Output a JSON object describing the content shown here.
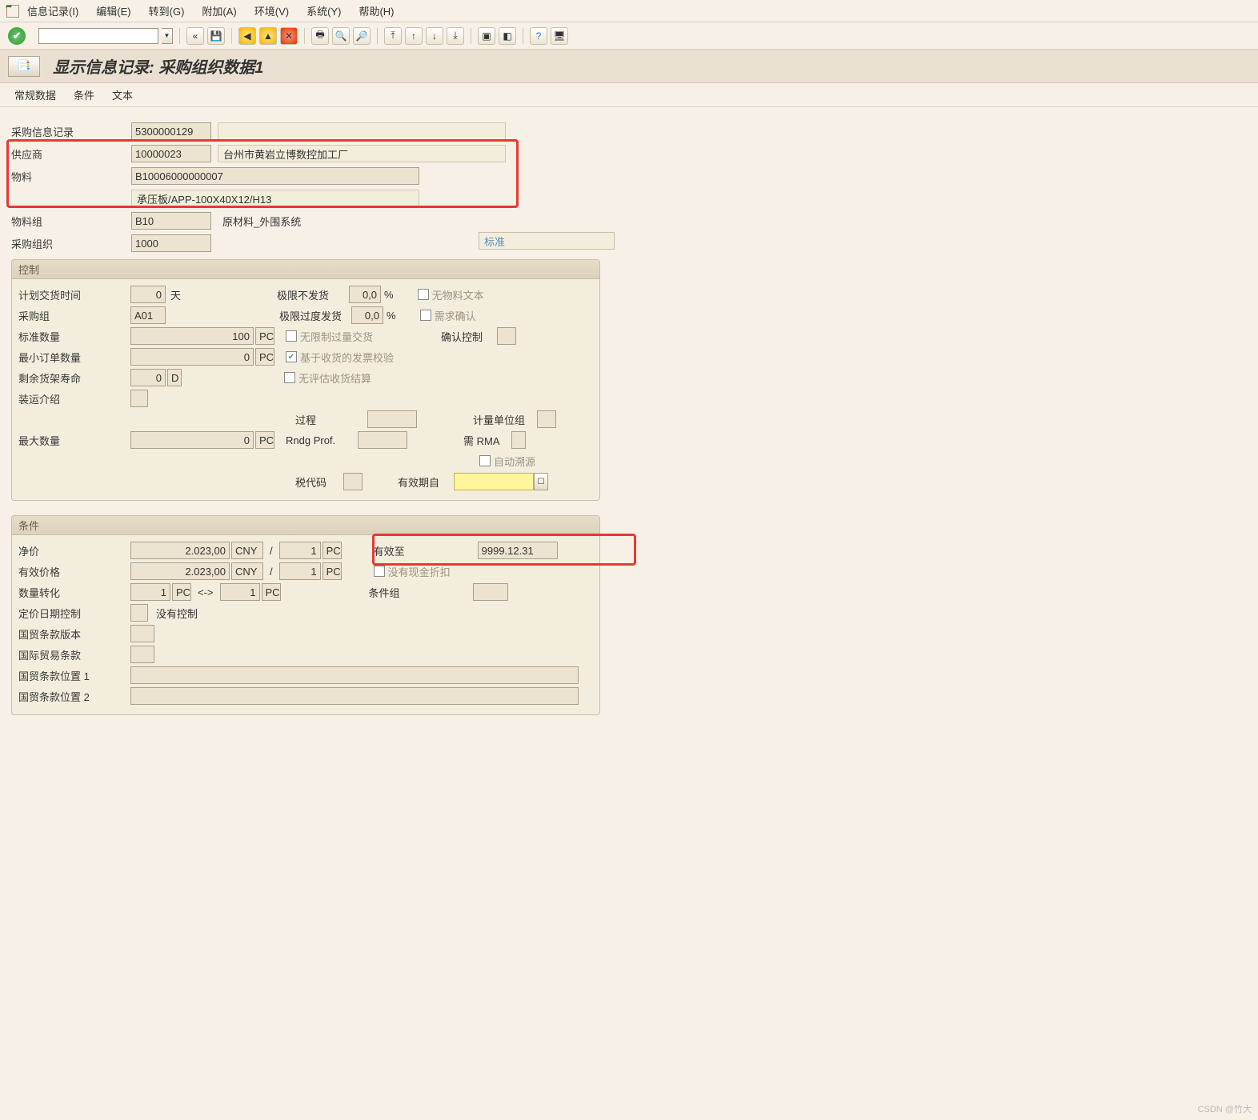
{
  "menubar": [
    "信息记录(I)",
    "编辑(E)",
    "转到(G)",
    "附加(A)",
    "环境(V)",
    "系统(Y)",
    "帮助(H)"
  ],
  "page_title": "显示信息记录: 采购组织数据1",
  "subtabs": [
    "常规数据",
    "条件",
    "文本"
  ],
  "header": {
    "record_label": "采购信息记录",
    "record": "5300000129",
    "vendor_label": "供应商",
    "vendor": "10000023",
    "vendor_name": "台州市黄岩立博数控加工厂",
    "material_label": "物料",
    "material": "B10006000000007",
    "mat_desc": "承压板/APP-100X40X12/H13",
    "matgrp_label": "物料组",
    "matgrp": "B10",
    "matgrp_desc": "原材料_外围系统",
    "porg_label": "采购组织",
    "porg": "1000",
    "standard": "标准"
  },
  "panel_ctrl": {
    "title": "控制",
    "deltime_l": "计划交货时间",
    "deltime": "0",
    "deltime_u": "天",
    "pgrp_l": "采购组",
    "pgrp": "A01",
    "stdqty_l": "标准数量",
    "stdqty": "100",
    "pc": "PC",
    "minqty_l": "最小订单数量",
    "minqty": "0",
    "shelf_l": "剩余货架寿命",
    "shelf": "0",
    "shelf_u": "D",
    "ship_l": "装运介绍",
    "maxqty_l": "最大数量",
    "maxqty": "0",
    "limit_no_l": "极限不发货",
    "limit_no": "0,0",
    "pct": "%",
    "limit_ov_l": "极限过度发货",
    "limit_ov": "0,0",
    "cb_unlim": "无限制过量交货",
    "cb_griv": "基于收货的发票校验",
    "cb_noeval": "无评估收货结算",
    "cb_nomatxt": "无物料文本",
    "cb_needconf": "需求确认",
    "conf_l": "确认控制",
    "proc_l": "过程",
    "uomgrp_l": "计量单位组",
    "rndg_l": "Rndg Prof.",
    "rma_l": "需 RMA",
    "auto_l": "自动溯源",
    "tax_l": "税代码",
    "valfrom_l": "有效期自"
  },
  "panel_cond": {
    "title": "条件",
    "net_l": "净价",
    "net": "2.023,00",
    "cur": "CNY",
    "slash": "/",
    "per": "1",
    "pc": "PC",
    "eff_l": "有效价格",
    "eff": "2.023,00",
    "qtyconv_l": "数量转化",
    "qtyconv_a": "1",
    "arrow": "<->",
    "qtyconv_b": "1",
    "dtctrl_l": "定价日期控制",
    "dtctrl_txt": "没有控制",
    "inco_ver_l": "国贸条款版本",
    "inco_l": "国际贸易条款",
    "inco_loc1_l": "国贸条款位置 1",
    "inco_loc2_l": "国贸条款位置 2",
    "validto_l": "有效至",
    "validto": "9999.12.31",
    "nocash_l": "没有现金折扣",
    "condgrp_l": "条件组"
  },
  "watermark": "CSDN @竹大"
}
